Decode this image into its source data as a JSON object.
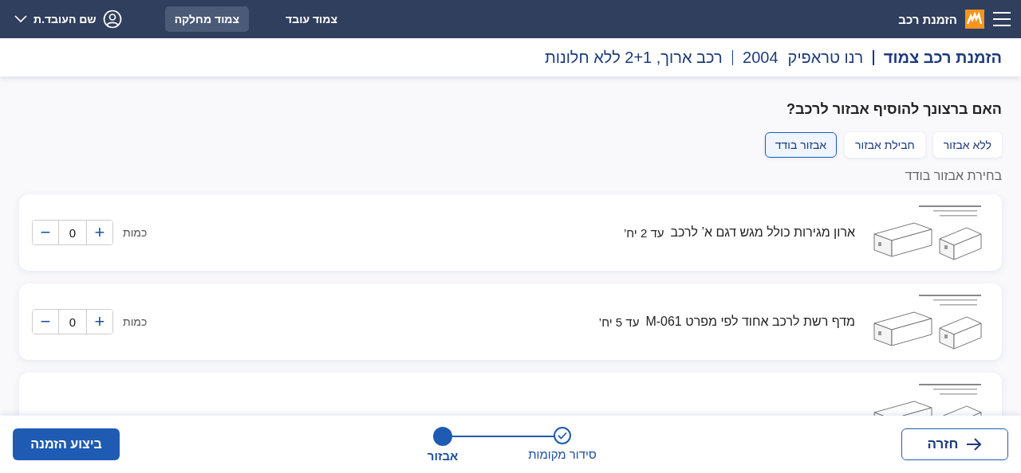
{
  "header": {
    "app_title": "הזמנת רכב",
    "nav": [
      {
        "label": "צמוד עובד",
        "selected": false
      },
      {
        "label": "צמוד מחלקה",
        "selected": true
      }
    ],
    "user": "שם העובד.ת"
  },
  "breadcrumb": {
    "title": "הזמנת רכב צמוד",
    "model": "רנו טראפיק",
    "year": "2004",
    "description": "רכב ארוך, 2+1 ללא חלונות"
  },
  "question": "האם ברצונך להוסיף אבזור לרכב?",
  "options": [
    {
      "label": "ללא אבזור",
      "selected": false
    },
    {
      "label": "חבילת אבזור",
      "selected": false
    },
    {
      "label": "אבזור בודד",
      "selected": true
    }
  ],
  "section_label": "בחירת אבזור בודד",
  "items": [
    {
      "title": "ארון מגירות כולל מגש דגם א’ לרכב",
      "limit": "עד 2 יח’",
      "quantity_label": "כמות",
      "quantity": "0",
      "plus": "+",
      "minus": "−"
    },
    {
      "title": "מדף רשת לרכב אחוד לפי מפרט M-061",
      "limit": "עד 5 יח’",
      "quantity_label": "כמות",
      "quantity": "0",
      "plus": "+",
      "minus": "−"
    },
    {
      "kind": "picture"
    }
  ],
  "footer": {
    "back": "חזרה",
    "steps": [
      {
        "label": "סידור מקומות",
        "completed": true,
        "selected": false
      },
      {
        "label": "אבזור",
        "completed": false,
        "selected": true
      }
    ],
    "submit": "ביצוע הזמנה"
  }
}
